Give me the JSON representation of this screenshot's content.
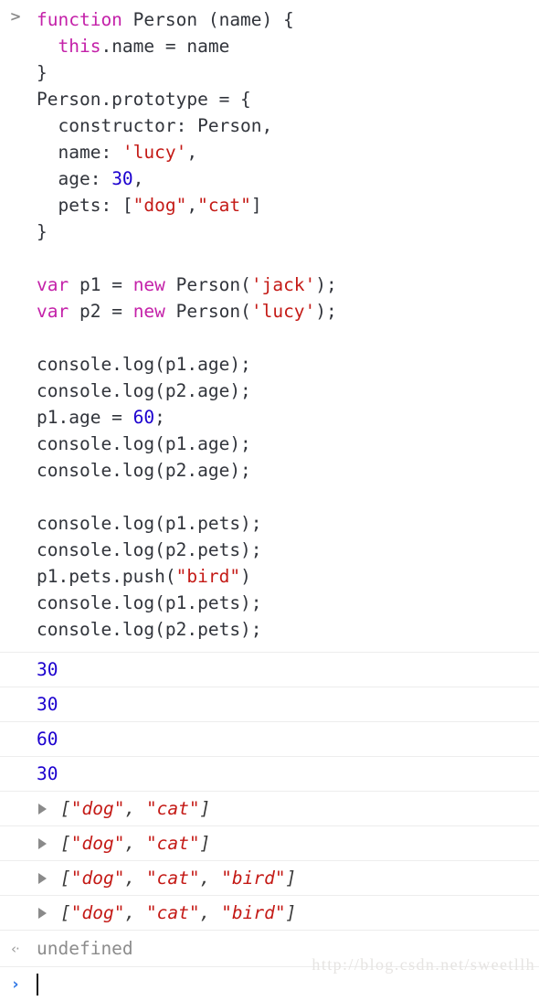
{
  "console": {
    "input_prompt_icon": "chevron-right-icon",
    "live_prompt_icon": "chevron-right-icon",
    "result_icon": "arrow-left-return-icon",
    "colors": {
      "keyword": "#c421a9",
      "string": "#c41a16",
      "number": "#1c00cf",
      "plain": "#31343b",
      "muted": "#8c8c8c",
      "prompt_blue": "#337ae6",
      "separator": "#ededed",
      "background": "#ffffff"
    },
    "code_lines": [
      [
        {
          "t": "function",
          "c": "kw"
        },
        {
          "t": " Person (name) {",
          "c": "pln"
        }
      ],
      [
        {
          "t": "  ",
          "c": "pln"
        },
        {
          "t": "this",
          "c": "kw"
        },
        {
          "t": ".name = name",
          "c": "pln"
        }
      ],
      [
        {
          "t": "}",
          "c": "pln"
        }
      ],
      [
        {
          "t": "Person.prototype = {",
          "c": "pln"
        }
      ],
      [
        {
          "t": "  constructor: Person,",
          "c": "pln"
        }
      ],
      [
        {
          "t": "  name: ",
          "c": "pln"
        },
        {
          "t": "'lucy'",
          "c": "str"
        },
        {
          "t": ",",
          "c": "pln"
        }
      ],
      [
        {
          "t": "  age: ",
          "c": "pln"
        },
        {
          "t": "30",
          "c": "num"
        },
        {
          "t": ",",
          "c": "pln"
        }
      ],
      [
        {
          "t": "  pets: [",
          "c": "pln"
        },
        {
          "t": "\"dog\"",
          "c": "str"
        },
        {
          "t": ",",
          "c": "pln"
        },
        {
          "t": "\"cat\"",
          "c": "str"
        },
        {
          "t": "]",
          "c": "pln"
        }
      ],
      [
        {
          "t": "}",
          "c": "pln"
        }
      ],
      [],
      [
        {
          "t": "var",
          "c": "kw"
        },
        {
          "t": " p1 = ",
          "c": "pln"
        },
        {
          "t": "new",
          "c": "kw"
        },
        {
          "t": " Person(",
          "c": "pln"
        },
        {
          "t": "'jack'",
          "c": "str"
        },
        {
          "t": ");",
          "c": "pln"
        }
      ],
      [
        {
          "t": "var",
          "c": "kw"
        },
        {
          "t": " p2 = ",
          "c": "pln"
        },
        {
          "t": "new",
          "c": "kw"
        },
        {
          "t": " Person(",
          "c": "pln"
        },
        {
          "t": "'lucy'",
          "c": "str"
        },
        {
          "t": ");",
          "c": "pln"
        }
      ],
      [],
      [
        {
          "t": "console.log(p1.age);",
          "c": "pln"
        }
      ],
      [
        {
          "t": "console.log(p2.age);",
          "c": "pln"
        }
      ],
      [
        {
          "t": "p1.age = ",
          "c": "pln"
        },
        {
          "t": "60",
          "c": "num"
        },
        {
          "t": ";",
          "c": "pln"
        }
      ],
      [
        {
          "t": "console.log(p1.age);",
          "c": "pln"
        }
      ],
      [
        {
          "t": "console.log(p2.age);",
          "c": "pln"
        }
      ],
      [],
      [
        {
          "t": "console.log(p1.pets);",
          "c": "pln"
        }
      ],
      [
        {
          "t": "console.log(p2.pets);",
          "c": "pln"
        }
      ],
      [
        {
          "t": "p1.pets.push(",
          "c": "pln"
        },
        {
          "t": "\"bird\"",
          "c": "str"
        },
        {
          "t": ")",
          "c": "pln"
        }
      ],
      [
        {
          "t": "console.log(p1.pets);",
          "c": "pln"
        }
      ],
      [
        {
          "t": "console.log(p2.pets);",
          "c": "pln"
        }
      ]
    ],
    "outputs": [
      {
        "kind": "number",
        "value": "30"
      },
      {
        "kind": "number",
        "value": "30"
      },
      {
        "kind": "number",
        "value": "60"
      },
      {
        "kind": "number",
        "value": "30"
      },
      {
        "kind": "array",
        "items": [
          "dog",
          "cat"
        ],
        "text": "[\"dog\", \"cat\"]"
      },
      {
        "kind": "array",
        "items": [
          "dog",
          "cat"
        ],
        "text": "[\"dog\", \"cat\"]"
      },
      {
        "kind": "array",
        "items": [
          "dog",
          "cat",
          "bird"
        ],
        "text": "[\"dog\", \"cat\", \"bird\"]"
      },
      {
        "kind": "array",
        "items": [
          "dog",
          "cat",
          "bird"
        ],
        "text": "[\"dog\", \"cat\", \"bird\"]"
      }
    ],
    "result": {
      "arrow": "‹·",
      "value": "undefined"
    },
    "live_prompt": {
      "chevron": "›",
      "value": ""
    },
    "watermark": "http://blog.csdn.net/sweetllh"
  }
}
